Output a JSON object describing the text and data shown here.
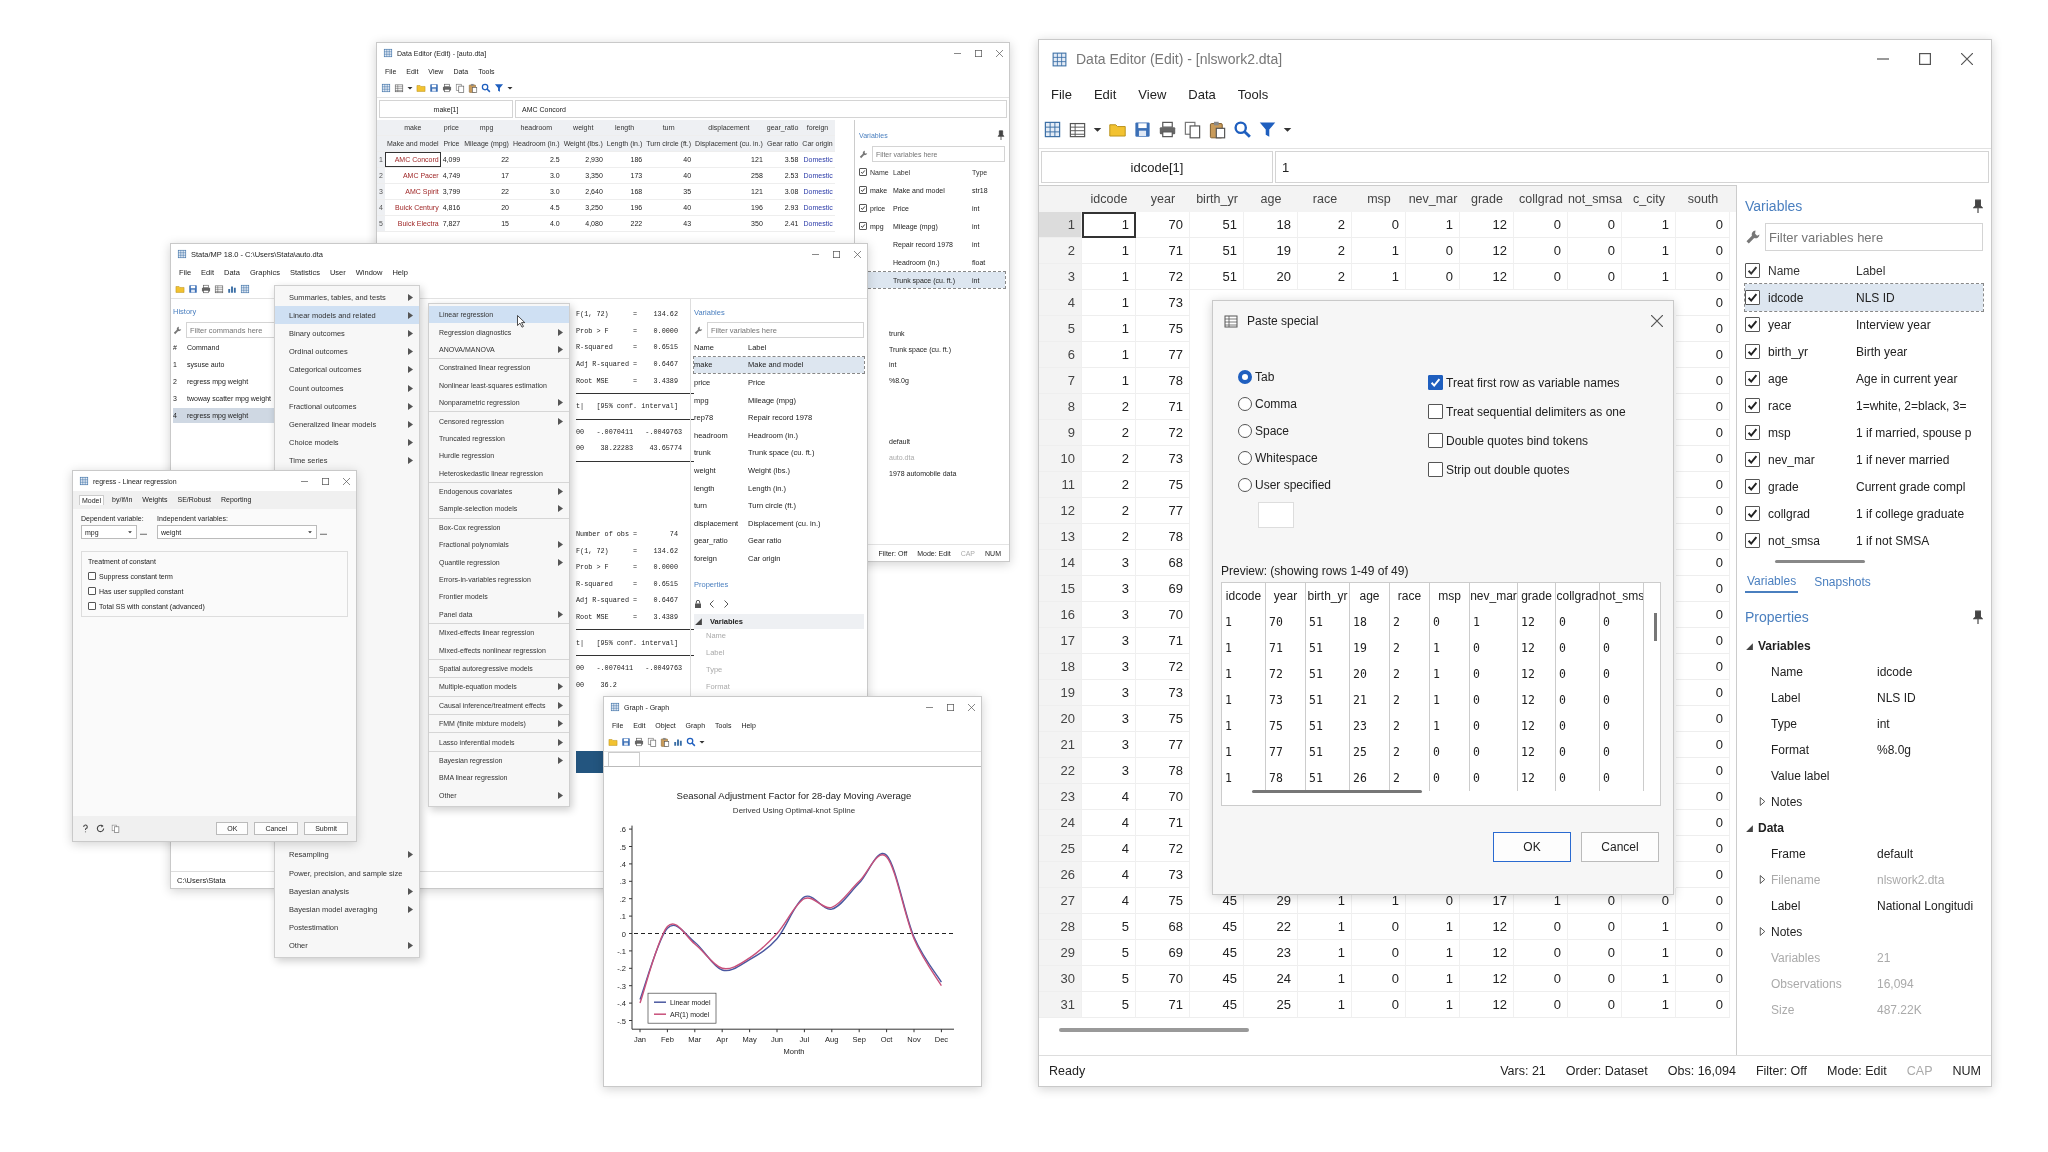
{
  "auto_editor": {
    "title": "Data Editor (Edit) - [auto.dta]",
    "menu": [
      "File",
      "Edit",
      "View",
      "Data",
      "Tools"
    ],
    "cell_ref": "make[1]",
    "cell_value": "AMC Concord",
    "columns": [
      {
        "name": "make",
        "label": "Make and model",
        "kind": "string"
      },
      {
        "name": "price",
        "label": "Price",
        "kind": "numeric"
      },
      {
        "name": "mpg",
        "label": "Mileage (mpg)",
        "kind": "numeric"
      },
      {
        "name": "headroom",
        "label": "Headroom (in.)",
        "kind": "numeric"
      },
      {
        "name": "weight",
        "label": "Weight (lbs.)",
        "kind": "numeric"
      },
      {
        "name": "length",
        "label": "Length (in.)",
        "kind": "numeric"
      },
      {
        "name": "turn",
        "label": "Turn circle (ft.)",
        "kind": "numeric"
      },
      {
        "name": "displacement",
        "label": "Displacement (cu. in.)",
        "kind": "numeric"
      },
      {
        "name": "gear_ratio",
        "label": "Gear ratio",
        "kind": "numeric"
      },
      {
        "name": "foreign",
        "label": "Car origin",
        "kind": "labeled"
      }
    ],
    "rows": [
      {
        "number": "1",
        "selected": true,
        "cells": [
          "AMC Concord",
          "4,099",
          "22",
          "2.5",
          "2,930",
          "186",
          "40",
          "121",
          "3.58",
          "Domestic"
        ]
      },
      {
        "number": "2",
        "selected": false,
        "cells": [
          "AMC Pacer",
          "4,749",
          "17",
          "3.0",
          "3,350",
          "173",
          "40",
          "258",
          "2.53",
          "Domestic"
        ]
      },
      {
        "number": "3",
        "selected": false,
        "cells": [
          "AMC Spirit",
          "3,799",
          "22",
          "3.0",
          "2,640",
          "168",
          "35",
          "121",
          "3.08",
          "Domestic"
        ]
      },
      {
        "number": "4",
        "selected": false,
        "cells": [
          "Buick Century",
          "4,816",
          "20",
          "4.5",
          "3,250",
          "196",
          "40",
          "196",
          "2.93",
          "Domestic"
        ]
      },
      {
        "number": "5",
        "selected": false,
        "cells": [
          "Buick Electra",
          "7,827",
          "15",
          "4.0",
          "4,080",
          "222",
          "43",
          "350",
          "2.41",
          "Domestic"
        ]
      }
    ],
    "variables": {
      "title": "Variables",
      "placeholder": "Filter variables here",
      "headers": [
        "Name",
        "Label",
        "Type"
      ],
      "header_checked": true,
      "rows": [
        {
          "name": "make",
          "label": "Make and model",
          "type": "str18",
          "checked": true,
          "selected": false
        },
        {
          "name": "price",
          "label": "Price",
          "type": "int",
          "checked": true,
          "selected": false
        },
        {
          "name": "mpg",
          "label": "Mileage (mpg)",
          "type": "int",
          "checked": true,
          "selected": false
        },
        {
          "label": "Repair record 1978",
          "type": "int",
          "selected": false
        },
        {
          "label": "Headroom (in.)",
          "type": "float",
          "selected": false
        },
        {
          "label": "Trunk space (cu. ft.)",
          "type": "int",
          "selected": true
        }
      ]
    },
    "property_values": [
      {
        "text": "trunk",
        "disabled": false
      },
      {
        "text": "Trunk space (cu. ft.)",
        "disabled": false
      },
      {
        "text": "int",
        "disabled": false
      },
      {
        "text": "%8.0g",
        "disabled": false
      },
      {
        "text": "default",
        "disabled": false
      },
      {
        "text": "auto.dta",
        "disabled": true
      },
      {
        "text": "1978 automobile data",
        "disabled": false
      }
    ],
    "status": [
      {
        "text": "Filter: Off",
        "disabled": false
      },
      {
        "text": "Mode: Edit",
        "disabled": false
      },
      {
        "text": "CAP",
        "disabled": true
      },
      {
        "text": "NUM",
        "disabled": false
      }
    ]
  },
  "stata": {
    "title": "Stata/MP 18.0 - C:\\Users\\Stata\\auto.dta",
    "menu": [
      "File",
      "Edit",
      "Data",
      "Graphics",
      "Statistics",
      "User",
      "Window",
      "Help"
    ],
    "history": {
      "title": "History",
      "placeholder": "Filter commands here",
      "headers": [
        "#",
        "Command"
      ],
      "rows": [
        {
          "number": "1",
          "command": "sysuse auto",
          "selected": false
        },
        {
          "number": "2",
          "command": "regress mpg weight",
          "selected": false
        },
        {
          "number": "3",
          "command": "twoway scatter mpg weight",
          "selected": false
        },
        {
          "number": "4",
          "command": "regress mpg weight",
          "selected": true
        }
      ]
    },
    "results": [
      {
        "kind": "text",
        "text": "F(1, 72)      =    134.62"
      },
      {
        "kind": "text",
        "text": "Prob > F      =    0.0000"
      },
      {
        "kind": "text",
        "text": "R-squared     =    0.6515"
      },
      {
        "kind": "text",
        "text": "Adj R-squared =    0.6467"
      },
      {
        "kind": "text",
        "text": "Root MSE      =    3.4389"
      },
      {
        "kind": "rule"
      },
      {
        "kind": "text",
        "text": "t|   [95% conf. interval]"
      },
      {
        "kind": "rule"
      },
      {
        "kind": "text",
        "text": "00   -.0070411   -.0049763"
      },
      {
        "kind": "text",
        "text": "00    38.22283    43.65774"
      },
      {
        "kind": "rule"
      },
      {
        "kind": "gap"
      },
      {
        "kind": "text",
        "text": "Number of obs =        74"
      },
      {
        "kind": "text",
        "text": "F(1, 72)      =    134.62"
      },
      {
        "kind": "text",
        "text": "Prob > F      =    0.0000"
      },
      {
        "kind": "text",
        "text": "R-squared     =    0.6515"
      },
      {
        "kind": "text",
        "text": "Adj R-squared =    0.6467"
      },
      {
        "kind": "text",
        "text": "Root MSE      =    3.4389"
      },
      {
        "kind": "rule"
      },
      {
        "kind": "text",
        "text": "t|   [95% conf. interval]"
      },
      {
        "kind": "rule"
      },
      {
        "kind": "text",
        "text": "00   -.0070411   -.0049763"
      },
      {
        "kind": "text",
        "text": "00    36.2"
      },
      {
        "kind": "bar"
      }
    ],
    "variables": {
      "title": "Variables",
      "placeholder": "Filter variables here",
      "headers": [
        "Name",
        "Label"
      ],
      "rows": [
        {
          "name": "make",
          "label": "Make and model",
          "selected": true
        },
        {
          "name": "price",
          "label": "Price",
          "selected": false
        },
        {
          "name": "mpg",
          "label": "Mileage (mpg)",
          "selected": false
        },
        {
          "name": "rep78",
          "label": "Repair record 1978",
          "selected": false
        },
        {
          "name": "headroom",
          "label": "Headroom (in.)",
          "selected": false
        },
        {
          "name": "trunk",
          "label": "Trunk space (cu. ft.)",
          "selected": false
        },
        {
          "name": "weight",
          "label": "Weight (lbs.)",
          "selected": false
        },
        {
          "name": "length",
          "label": "Length (in.)",
          "selected": false
        },
        {
          "name": "turn",
          "label": "Turn circle (ft.)",
          "selected": false
        },
        {
          "name": "displacement",
          "label": "Displacement (cu. in.)",
          "selected": false
        },
        {
          "name": "gear_ratio",
          "label": "Gear ratio",
          "selected": false
        },
        {
          "name": "foreign",
          "label": "Car origin",
          "selected": false
        }
      ]
    },
    "properties": {
      "title": "Properties",
      "group": "Variables",
      "fields": [
        "Name",
        "Label",
        "Type",
        "Format"
      ]
    },
    "status": "C:\\Users\\Stata"
  },
  "statistics_menu": {
    "items_top": [
      {
        "label": "Summaries, tables, and tests",
        "submenu": true,
        "selected": false
      },
      {
        "label": "Linear models and related",
        "submenu": true,
        "selected": true
      },
      {
        "label": "Binary outcomes",
        "submenu": true,
        "selected": false
      },
      {
        "label": "Ordinal outcomes",
        "submenu": true,
        "selected": false
      },
      {
        "label": "Categorical outcomes",
        "submenu": true,
        "selected": false
      },
      {
        "label": "Count outcomes",
        "submenu": true,
        "selected": false
      },
      {
        "label": "Fractional outcomes",
        "submenu": true,
        "selected": false
      },
      {
        "label": "Generalized linear models",
        "submenu": true,
        "selected": false
      },
      {
        "label": "Choice models",
        "submenu": true,
        "selected": false
      },
      {
        "label": "Time series",
        "submenu": true,
        "selected": false
      }
    ],
    "items_bottom": [
      {
        "label": "Resampling",
        "submenu": true,
        "selected": false
      },
      {
        "label": "Power, precision, and sample size",
        "submenu": false,
        "selected": false
      },
      {
        "label": "Bayesian analysis",
        "submenu": true,
        "selected": false
      },
      {
        "label": "Bayesian model averaging",
        "submenu": true,
        "selected": false
      },
      {
        "label": "Postestimation",
        "submenu": false,
        "selected": false
      },
      {
        "label": "Other",
        "submenu": true,
        "selected": false
      }
    ]
  },
  "linear_submenu": {
    "items": [
      {
        "label": "Linear regression",
        "submenu": false,
        "separator_before": false,
        "selected": true
      },
      {
        "label": "Regression diagnostics",
        "submenu": true,
        "separator_before": false,
        "selected": false
      },
      {
        "label": "ANOVA/MANOVA",
        "submenu": true,
        "separator_before": false,
        "selected": false
      },
      {
        "label": "Constrained linear regression",
        "submenu": false,
        "separator_before": true,
        "selected": false
      },
      {
        "label": "Nonlinear least-squares estimation",
        "submenu": false,
        "separator_before": false,
        "selected": false
      },
      {
        "label": "Nonparametric regression",
        "submenu": true,
        "separator_before": false,
        "selected": false
      },
      {
        "label": "Censored regression",
        "submenu": true,
        "separator_before": true,
        "selected": false
      },
      {
        "label": "Truncated regression",
        "submenu": false,
        "separator_before": false,
        "selected": false
      },
      {
        "label": "Hurdle regression",
        "submenu": false,
        "separator_before": false,
        "selected": false
      },
      {
        "label": "Heteroskedastic linear regression",
        "submenu": false,
        "separator_before": false,
        "selected": false
      },
      {
        "label": "Endogenous covariates",
        "submenu": true,
        "separator_before": true,
        "selected": false
      },
      {
        "label": "Sample-selection models",
        "submenu": true,
        "separator_before": false,
        "selected": false
      },
      {
        "label": "Box-Cox regression",
        "submenu": false,
        "separator_before": true,
        "selected": false
      },
      {
        "label": "Fractional polynomials",
        "submenu": true,
        "separator_before": false,
        "selected": false
      },
      {
        "label": "Quantile regression",
        "submenu": true,
        "separator_before": false,
        "selected": false
      },
      {
        "label": "Errors-in-variables regression",
        "submenu": false,
        "separator_before": false,
        "selected": false
      },
      {
        "label": "Frontier models",
        "submenu": false,
        "separator_before": false,
        "selected": false
      },
      {
        "label": "Panel data",
        "submenu": true,
        "separator_before": false,
        "selected": false
      },
      {
        "label": "Mixed-effects linear regression",
        "submenu": false,
        "separator_before": true,
        "selected": false
      },
      {
        "label": "Mixed-effects nonlinear regression",
        "submenu": false,
        "separator_before": false,
        "selected": false
      },
      {
        "label": "Spatial autoregressive models",
        "submenu": false,
        "separator_before": true,
        "selected": false
      },
      {
        "label": "Multiple-equation models",
        "submenu": true,
        "separator_before": true,
        "selected": false
      },
      {
        "label": "Causal inference/treatment effects",
        "submenu": true,
        "separator_before": true,
        "selected": false
      },
      {
        "label": "FMM (finite mixture models)",
        "submenu": true,
        "separator_before": true,
        "selected": false
      },
      {
        "label": "Lasso inferential models",
        "submenu": true,
        "separator_before": true,
        "selected": false
      },
      {
        "label": "Bayesian regression",
        "submenu": true,
        "separator_before": true,
        "selected": false
      },
      {
        "label": "BMA linear regression",
        "submenu": false,
        "separator_before": false,
        "selected": false
      },
      {
        "label": "Other",
        "submenu": true,
        "separator_before": false,
        "selected": false
      }
    ]
  },
  "regress_dialog": {
    "title": "regress - Linear regression",
    "tabs": [
      {
        "label": "Model",
        "selected": true
      },
      {
        "label": "by/if/in",
        "selected": false
      },
      {
        "label": "Weights",
        "selected": false
      },
      {
        "label": "SE/Robust",
        "selected": false
      },
      {
        "label": "Reporting",
        "selected": false
      }
    ],
    "dependent": {
      "label": "Dependent variable:",
      "value": "mpg"
    },
    "independent": {
      "label": "Independent variables:",
      "value": "weight"
    },
    "group": "Treatment of constant",
    "options": [
      {
        "label": "Suppress constant term",
        "checked": false
      },
      {
        "label": "Has user supplied constant",
        "checked": false
      },
      {
        "label": "Total SS with constant (advanced)",
        "checked": false
      }
    ],
    "buttons": [
      "OK",
      "Cancel",
      "Submit"
    ]
  },
  "graph": {
    "title": "Graph - Graph",
    "menu": [
      "File",
      "Edit",
      "Object",
      "Graph",
      "Tools",
      "Help"
    ],
    "subtitle": "Derived Using Optimal-knot Spline",
    "chart_data": {
      "type": "line",
      "title": "Seasonal Adjustment Factor for 28-day Moving Average",
      "xlabel": "Month",
      "categories": [
        "Jan",
        "Feb",
        "Mar",
        "Apr",
        "May",
        "Jun",
        "Jul",
        "Aug",
        "Sep",
        "Oct",
        "Nov",
        "Dec"
      ],
      "yticks": [
        {
          "value": 0.6,
          "label": ".6"
        },
        {
          "value": 0.5,
          "label": ".5"
        },
        {
          "value": 0.4,
          "label": ".4"
        },
        {
          "value": 0.3,
          "label": ".3"
        },
        {
          "value": 0.2,
          "label": ".2"
        },
        {
          "value": 0.1,
          "label": ".1"
        },
        {
          "value": 0,
          "label": "0"
        },
        {
          "value": -0.1,
          "label": "-.1"
        },
        {
          "value": -0.2,
          "label": "-.2"
        },
        {
          "value": -0.3,
          "label": "-.3"
        },
        {
          "value": -0.4,
          "label": "-.4"
        },
        {
          "value": -0.5,
          "label": "-.5"
        }
      ],
      "ylim": [
        -0.55,
        0.62
      ],
      "legend": true,
      "series": [
        {
          "name": "Linear model",
          "color": "#4a58a0",
          "values": [
            -0.38,
            0.03,
            -0.05,
            -0.21,
            -0.15,
            -0.03,
            0.21,
            0.14,
            0.29,
            0.45,
            -0.02,
            -0.28
          ]
        },
        {
          "name": "AR(1) model",
          "color": "#c8507a",
          "values": [
            -0.4,
            0.04,
            -0.06,
            -0.2,
            -0.14,
            0.0,
            0.2,
            0.15,
            0.3,
            0.44,
            -0.03,
            -0.3
          ]
        }
      ]
    }
  },
  "data_editor": {
    "title": "Data Editor (Edit) - [nlswork2.dta]",
    "menu": [
      "File",
      "Edit",
      "View",
      "Data",
      "Tools"
    ],
    "cell_ref": "idcode[1]",
    "cell_value": "1",
    "columns": [
      "idcode",
      "year",
      "birth_yr",
      "age",
      "race",
      "msp",
      "nev_mar",
      "grade",
      "collgrad",
      "not_smsa",
      "c_city",
      "south"
    ],
    "rows": [
      {
        "number": "1",
        "selected": true,
        "cells": [
          "1",
          "70",
          "51",
          "18",
          "2",
          "0",
          "1",
          "12",
          "0",
          "0",
          "1",
          "0"
        ]
      },
      {
        "number": "2",
        "selected": false,
        "cells": [
          "1",
          "71",
          "51",
          "19",
          "2",
          "1",
          "0",
          "12",
          "0",
          "0",
          "1",
          "0"
        ]
      },
      {
        "number": "3",
        "selected": false,
        "cells": [
          "1",
          "72",
          "51",
          "20",
          "2",
          "1",
          "0",
          "12",
          "0",
          "0",
          "1",
          "0"
        ]
      },
      {
        "number": "4",
        "selected": false,
        "cells": [
          "1",
          "73",
          null,
          null,
          null,
          null,
          null,
          null,
          null,
          null,
          null,
          "0"
        ]
      },
      {
        "number": "5",
        "selected": false,
        "cells": [
          "1",
          "75",
          null,
          null,
          null,
          null,
          null,
          null,
          null,
          null,
          null,
          "0"
        ]
      },
      {
        "number": "6",
        "selected": false,
        "cells": [
          "1",
          "77",
          null,
          null,
          null,
          null,
          null,
          null,
          null,
          null,
          null,
          "0"
        ]
      },
      {
        "number": "7",
        "selected": false,
        "cells": [
          "1",
          "78",
          null,
          null,
          null,
          null,
          null,
          null,
          null,
          null,
          null,
          "0"
        ]
      },
      {
        "number": "8",
        "selected": false,
        "cells": [
          "2",
          "71",
          null,
          null,
          null,
          null,
          null,
          null,
          null,
          null,
          null,
          "0"
        ]
      },
      {
        "number": "9",
        "selected": false,
        "cells": [
          "2",
          "72",
          null,
          null,
          null,
          null,
          null,
          null,
          null,
          null,
          null,
          "0"
        ]
      },
      {
        "number": "10",
        "selected": false,
        "cells": [
          "2",
          "73",
          null,
          null,
          null,
          null,
          null,
          null,
          null,
          null,
          null,
          "0"
        ]
      },
      {
        "number": "11",
        "selected": false,
        "cells": [
          "2",
          "75",
          null,
          null,
          null,
          null,
          null,
          null,
          null,
          null,
          null,
          "0"
        ]
      },
      {
        "number": "12",
        "selected": false,
        "cells": [
          "2",
          "77",
          null,
          null,
          null,
          null,
          null,
          null,
          null,
          null,
          null,
          "0"
        ]
      },
      {
        "number": "13",
        "selected": false,
        "cells": [
          "2",
          "78",
          null,
          null,
          null,
          null,
          null,
          null,
          null,
          null,
          null,
          "0"
        ]
      },
      {
        "number": "14",
        "selected": false,
        "cells": [
          "3",
          "68",
          null,
          null,
          null,
          null,
          null,
          null,
          null,
          null,
          null,
          "0"
        ]
      },
      {
        "number": "15",
        "selected": false,
        "cells": [
          "3",
          "69",
          null,
          null,
          null,
          null,
          null,
          null,
          null,
          null,
          null,
          "0"
        ]
      },
      {
        "number": "16",
        "selected": false,
        "cells": [
          "3",
          "70",
          null,
          null,
          null,
          null,
          null,
          null,
          null,
          null,
          null,
          "0"
        ]
      },
      {
        "number": "17",
        "selected": false,
        "cells": [
          "3",
          "71",
          null,
          null,
          null,
          null,
          null,
          null,
          null,
          null,
          null,
          "0"
        ]
      },
      {
        "number": "18",
        "selected": false,
        "cells": [
          "3",
          "72",
          null,
          null,
          null,
          null,
          null,
          null,
          null,
          null,
          null,
          "0"
        ]
      },
      {
        "number": "19",
        "selected": false,
        "cells": [
          "3",
          "73",
          null,
          null,
          null,
          null,
          null,
          null,
          null,
          null,
          null,
          "0"
        ]
      },
      {
        "number": "20",
        "selected": false,
        "cells": [
          "3",
          "75",
          null,
          null,
          null,
          null,
          null,
          null,
          null,
          null,
          null,
          "0"
        ]
      },
      {
        "number": "21",
        "selected": false,
        "cells": [
          "3",
          "77",
          null,
          null,
          null,
          null,
          null,
          null,
          null,
          null,
          null,
          "0"
        ]
      },
      {
        "number": "22",
        "selected": false,
        "cells": [
          "3",
          "78",
          null,
          null,
          null,
          null,
          null,
          null,
          null,
          null,
          null,
          "0"
        ]
      },
      {
        "number": "23",
        "selected": false,
        "cells": [
          "4",
          "70",
          null,
          null,
          null,
          null,
          null,
          null,
          null,
          null,
          null,
          "0"
        ]
      },
      {
        "number": "24",
        "selected": false,
        "cells": [
          "4",
          "71",
          null,
          null,
          null,
          null,
          null,
          null,
          null,
          null,
          null,
          "0"
        ]
      },
      {
        "number": "25",
        "selected": false,
        "cells": [
          "4",
          "72",
          null,
          null,
          null,
          null,
          null,
          null,
          null,
          null,
          null,
          "0"
        ]
      },
      {
        "number": "26",
        "selected": false,
        "cells": [
          "4",
          "73",
          null,
          null,
          null,
          null,
          null,
          null,
          null,
          null,
          null,
          "0"
        ]
      },
      {
        "number": "27",
        "selected": false,
        "cells": [
          "4",
          "75",
          "45",
          "29",
          "1",
          "1",
          "0",
          "17",
          "1",
          "0",
          "0",
          "0"
        ]
      },
      {
        "number": "28",
        "selected": false,
        "cells": [
          "5",
          "68",
          "45",
          "22",
          "1",
          "0",
          "1",
          "12",
          "0",
          "0",
          "1",
          "0"
        ]
      },
      {
        "number": "29",
        "selected": false,
        "cells": [
          "5",
          "69",
          "45",
          "23",
          "1",
          "0",
          "1",
          "12",
          "0",
          "0",
          "1",
          "0"
        ]
      },
      {
        "number": "30",
        "selected": false,
        "cells": [
          "5",
          "70",
          "45",
          "24",
          "1",
          "0",
          "1",
          "12",
          "0",
          "0",
          "1",
          "0"
        ]
      },
      {
        "number": "31",
        "selected": false,
        "cells": [
          "5",
          "71",
          "45",
          "25",
          "1",
          "0",
          "1",
          "12",
          "0",
          "0",
          "1",
          "0"
        ]
      }
    ],
    "variables": {
      "title": "Variables",
      "placeholder": "Filter variables here",
      "headers": [
        "Name",
        "Label"
      ],
      "header_checked": true,
      "rows": [
        {
          "name": "idcode",
          "label": "NLS ID",
          "checked": true,
          "selected": true
        },
        {
          "name": "year",
          "label": "Interview year",
          "checked": true,
          "selected": false
        },
        {
          "name": "birth_yr",
          "label": "Birth year",
          "checked": true,
          "selected": false
        },
        {
          "name": "age",
          "label": "Age in current year",
          "checked": true,
          "selected": false
        },
        {
          "name": "race",
          "label": "1=white, 2=black, 3=",
          "checked": true,
          "selected": false
        },
        {
          "name": "msp",
          "label": "1 if married, spouse p",
          "checked": true,
          "selected": false
        },
        {
          "name": "nev_mar",
          "label": "1 if never married",
          "checked": true,
          "selected": false
        },
        {
          "name": "grade",
          "label": "Current grade compl",
          "checked": true,
          "selected": false
        },
        {
          "name": "collgrad",
          "label": "1 if college graduate",
          "checked": true,
          "selected": false
        },
        {
          "name": "not_smsa",
          "label": "1 if not SMSA",
          "checked": true,
          "selected": false
        }
      ]
    },
    "panel_tabs": [
      {
        "label": "Variables",
        "selected": true
      },
      {
        "label": "Snapshots",
        "selected": false
      }
    ],
    "properties": {
      "title": "Properties",
      "groups": [
        {
          "label": "Variables",
          "expanded": true,
          "fields": [
            {
              "name": "Name",
              "value": "idcode",
              "disabled": false
            },
            {
              "name": "Label",
              "value": "NLS ID",
              "disabled": false
            },
            {
              "name": "Type",
              "value": "int",
              "disabled": false
            },
            {
              "name": "Format",
              "value": "%8.0g",
              "disabled": false
            },
            {
              "name": "Value label",
              "disabled": false
            },
            {
              "name": "Notes",
              "expanded": false,
              "disabled": false
            }
          ]
        },
        {
          "label": "Data",
          "expanded": true,
          "fields": [
            {
              "name": "Frame",
              "value": "default",
              "disabled": false
            },
            {
              "name": "Filename",
              "value": "nlswork2.dta",
              "expanded": false,
              "disabled": true
            },
            {
              "name": "Label",
              "value": "National Longitudi",
              "disabled": false
            },
            {
              "name": "Notes",
              "expanded": false,
              "disabled": false
            },
            {
              "name": "Variables",
              "value": "21",
              "disabled": true
            },
            {
              "name": "Observations",
              "value": "16,094",
              "disabled": true
            },
            {
              "name": "Size",
              "value": "487.22K",
              "disabled": true
            }
          ]
        }
      ]
    },
    "status": {
      "left": "Ready",
      "items": [
        {
          "text": "Vars: 21",
          "disabled": false
        },
        {
          "text": "Order: Dataset",
          "disabled": false
        },
        {
          "text": "Obs: 16,094",
          "disabled": false
        },
        {
          "text": "Filter: Off",
          "disabled": false
        },
        {
          "text": "Mode: Edit",
          "disabled": false
        },
        {
          "text": "CAP",
          "disabled": true
        },
        {
          "text": "NUM",
          "disabled": false
        }
      ]
    }
  },
  "paste_special": {
    "title": "Paste special",
    "delimiters": [
      {
        "label": "Tab",
        "selected": true
      },
      {
        "label": "Comma",
        "selected": false
      },
      {
        "label": "Space",
        "selected": false
      },
      {
        "label": "Whitespace",
        "selected": false
      },
      {
        "label": "User specified",
        "selected": false
      }
    ],
    "options": [
      {
        "label": "Treat first row as variable names",
        "checked": true
      },
      {
        "label": "Treat sequential delimiters as one",
        "checked": false
      },
      {
        "label": "Double quotes bind tokens",
        "checked": false
      },
      {
        "label": "Strip out double quotes",
        "checked": false
      }
    ],
    "preview_label": "Preview: (showing rows 1-49 of 49)",
    "preview_columns": [
      "idcode",
      "year",
      "birth_yr",
      "age",
      "race",
      "msp",
      "nev_mar",
      "grade",
      "collgrad",
      "not_sms"
    ],
    "preview_rows": [
      [
        "1",
        "70",
        "51",
        "18",
        "2",
        "0",
        "1",
        "12",
        "0",
        "0"
      ],
      [
        "1",
        "71",
        "51",
        "19",
        "2",
        "1",
        "0",
        "12",
        "0",
        "0"
      ],
      [
        "1",
        "72",
        "51",
        "20",
        "2",
        "1",
        "0",
        "12",
        "0",
        "0"
      ],
      [
        "1",
        "73",
        "51",
        "21",
        "2",
        "1",
        "0",
        "12",
        "0",
        "0"
      ],
      [
        "1",
        "75",
        "51",
        "23",
        "2",
        "1",
        "0",
        "12",
        "0",
        "0"
      ],
      [
        "1",
        "77",
        "51",
        "25",
        "2",
        "0",
        "0",
        "12",
        "0",
        "0"
      ],
      [
        "1",
        "78",
        "51",
        "26",
        "2",
        "0",
        "0",
        "12",
        "0",
        "0"
      ]
    ],
    "buttons": [
      {
        "label": "OK",
        "default": true
      },
      {
        "label": "Cancel",
        "default": false
      }
    ]
  }
}
